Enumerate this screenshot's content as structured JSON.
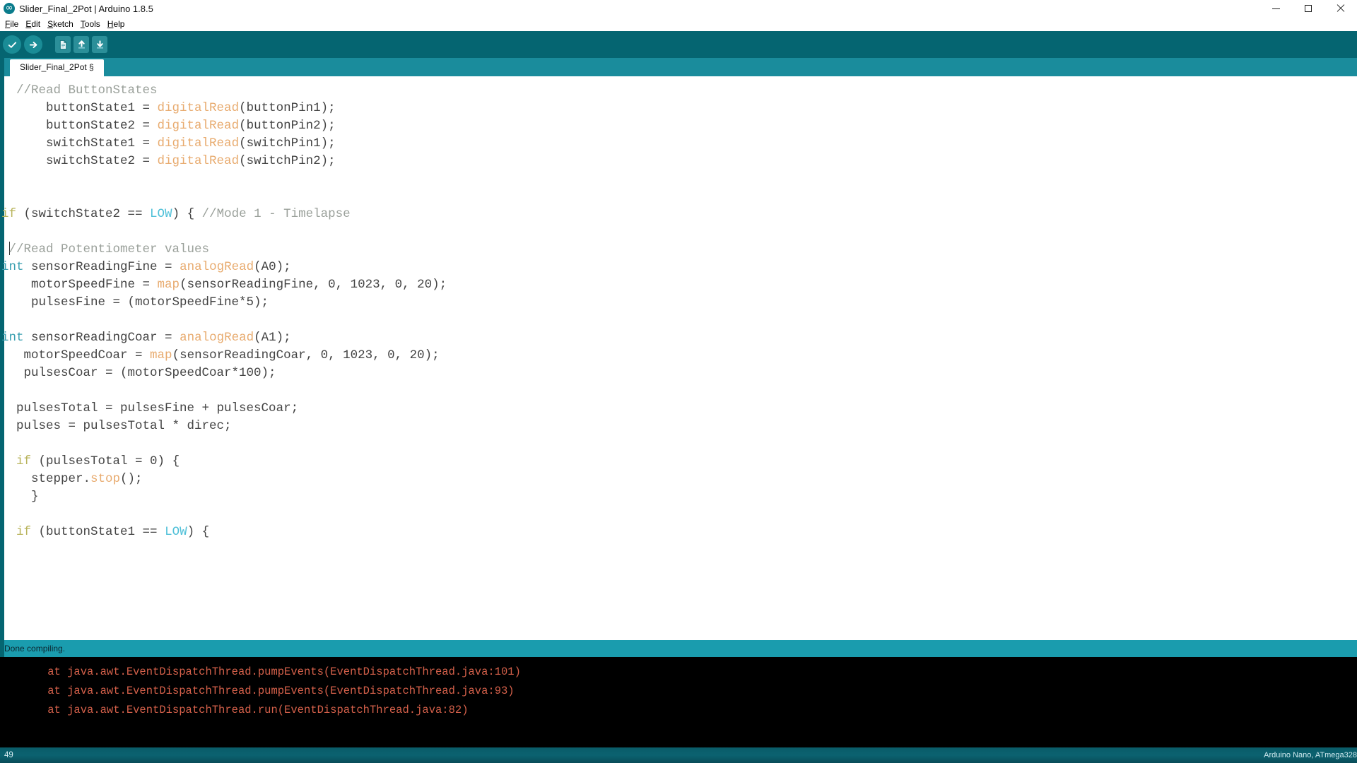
{
  "window": {
    "title": "Slider_Final_2Pot | Arduino 1.8.5",
    "logo_icon": "arduino-infinity-icon",
    "minimize_icon": "minimize-icon",
    "maximize_icon": "maximize-icon",
    "close_icon": "close-icon"
  },
  "menubar": {
    "items": [
      {
        "mnemonic": "F",
        "rest": "ile"
      },
      {
        "mnemonic": "E",
        "rest": "dit"
      },
      {
        "mnemonic": "S",
        "rest": "ketch"
      },
      {
        "mnemonic": "T",
        "rest": "ools"
      },
      {
        "mnemonic": "H",
        "rest": "elp"
      }
    ]
  },
  "toolbar": {
    "buttons": [
      {
        "name": "verify-button",
        "icon": "checkmark-icon",
        "tooltip": "Verify"
      },
      {
        "name": "upload-button",
        "icon": "arrow-right-icon",
        "tooltip": "Upload"
      },
      {
        "name": "new-button",
        "icon": "new-file-icon",
        "tooltip": "New"
      },
      {
        "name": "open-button",
        "icon": "arrow-up-icon",
        "tooltip": "Open"
      },
      {
        "name": "save-button",
        "icon": "arrow-down-icon",
        "tooltip": "Save"
      }
    ]
  },
  "tabs": [
    {
      "label": "Slider_Final_2Pot §",
      "active": true
    }
  ],
  "editor": {
    "lines": [
      [
        {
          "t": "comment",
          "s": "  //Read ButtonStates"
        }
      ],
      [
        {
          "t": "plain",
          "s": "      buttonState1 = "
        },
        {
          "t": "fn",
          "s": "digitalRead"
        },
        {
          "t": "plain",
          "s": "(buttonPin1);"
        }
      ],
      [
        {
          "t": "plain",
          "s": "      buttonState2 = "
        },
        {
          "t": "fn",
          "s": "digitalRead"
        },
        {
          "t": "plain",
          "s": "(buttonPin2);"
        }
      ],
      [
        {
          "t": "plain",
          "s": "      switchState1 = "
        },
        {
          "t": "fn",
          "s": "digitalRead"
        },
        {
          "t": "plain",
          "s": "(switchPin1);"
        }
      ],
      [
        {
          "t": "plain",
          "s": "      switchState2 = "
        },
        {
          "t": "fn",
          "s": "digitalRead"
        },
        {
          "t": "plain",
          "s": "(switchPin2);"
        }
      ],
      [
        {
          "t": "plain",
          "s": ""
        }
      ],
      [
        {
          "t": "plain",
          "s": ""
        }
      ],
      [
        {
          "t": "kw",
          "s": "if"
        },
        {
          "t": "plain",
          "s": " (switchState2 == "
        },
        {
          "t": "const",
          "s": "LOW"
        },
        {
          "t": "plain",
          "s": ") { "
        },
        {
          "t": "comment",
          "s": "//Mode 1 - Timelapse"
        }
      ],
      [
        {
          "t": "plain",
          "s": ""
        }
      ],
      [
        {
          "t": "plain",
          "s": " "
        },
        {
          "t": "caret",
          "s": ""
        },
        {
          "t": "comment",
          "s": "//Read Potentiometer values"
        }
      ],
      [
        {
          "t": "type",
          "s": "int"
        },
        {
          "t": "plain",
          "s": " sensorReadingFine = "
        },
        {
          "t": "fn",
          "s": "analogRead"
        },
        {
          "t": "plain",
          "s": "(A0);"
        }
      ],
      [
        {
          "t": "plain",
          "s": "    motorSpeedFine = "
        },
        {
          "t": "fn",
          "s": "map"
        },
        {
          "t": "plain",
          "s": "(sensorReadingFine, 0, 1023, 0, 20);"
        }
      ],
      [
        {
          "t": "plain",
          "s": "    pulsesFine = (motorSpeedFine*5);"
        }
      ],
      [
        {
          "t": "plain",
          "s": ""
        }
      ],
      [
        {
          "t": "type",
          "s": "int"
        },
        {
          "t": "plain",
          "s": " sensorReadingCoar = "
        },
        {
          "t": "fn",
          "s": "analogRead"
        },
        {
          "t": "plain",
          "s": "(A1);"
        }
      ],
      [
        {
          "t": "plain",
          "s": "   motorSpeedCoar = "
        },
        {
          "t": "fn",
          "s": "map"
        },
        {
          "t": "plain",
          "s": "(sensorReadingCoar, 0, 1023, 0, 20);"
        }
      ],
      [
        {
          "t": "plain",
          "s": "   pulsesCoar = (motorSpeedCoar*100);"
        }
      ],
      [
        {
          "t": "plain",
          "s": ""
        }
      ],
      [
        {
          "t": "plain",
          "s": "  pulsesTotal = pulsesFine + pulsesCoar;"
        }
      ],
      [
        {
          "t": "plain",
          "s": "  pulses = pulsesTotal * direc;"
        }
      ],
      [
        {
          "t": "plain",
          "s": ""
        }
      ],
      [
        {
          "t": "plain",
          "s": "  "
        },
        {
          "t": "kw",
          "s": "if"
        },
        {
          "t": "plain",
          "s": " (pulsesTotal = 0) {"
        }
      ],
      [
        {
          "t": "plain",
          "s": "    stepper."
        },
        {
          "t": "fn",
          "s": "stop"
        },
        {
          "t": "plain",
          "s": "();"
        }
      ],
      [
        {
          "t": "plain",
          "s": "    }"
        }
      ],
      [
        {
          "t": "plain",
          "s": ""
        }
      ],
      [
        {
          "t": "plain",
          "s": "  "
        },
        {
          "t": "kw",
          "s": "if"
        },
        {
          "t": "plain",
          "s": " (buttonState1 == "
        },
        {
          "t": "const",
          "s": "LOW"
        },
        {
          "t": "plain",
          "s": ") {"
        }
      ]
    ]
  },
  "console": {
    "status": "Done compiling.",
    "lines": [
      "    at java.awt.EventDispatchThread.pumpEvents(EventDispatchThread.java:101)",
      "    at java.awt.EventDispatchThread.pumpEvents(EventDispatchThread.java:93)",
      "    at java.awt.EventDispatchThread.run(EventDispatchThread.java:82)"
    ]
  },
  "statusbar": {
    "line_number": "49",
    "board": "Arduino Nano, ATmega328"
  },
  "colors": {
    "toolbar_bg": "#056571",
    "tabstrip_bg": "#1a8c9c",
    "console_status_bg": "#1a9cae",
    "console_bg": "#000000",
    "console_text": "#d4604a",
    "statusbar_bg": "#0b6270",
    "token_comment": "#9aa09a",
    "token_keyword": "#b9b45c",
    "token_type": "#3a9fb0",
    "token_constant": "#4fc0d8",
    "token_function": "#e8ab6f",
    "token_plain": "#434343"
  }
}
